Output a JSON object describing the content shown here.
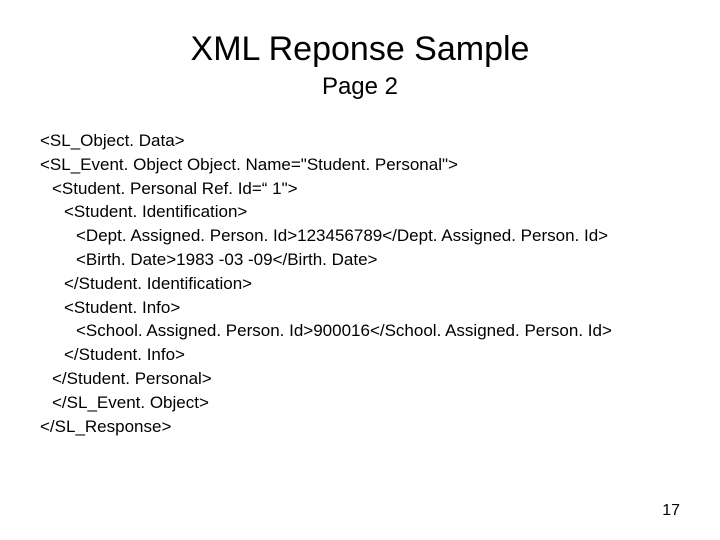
{
  "title": "XML Reponse Sample",
  "subtitle": "Page 2",
  "code_lines": [
    {
      "text": "<SL_Object. Data>",
      "indent": 0
    },
    {
      "text": "<SL_Event. Object Object. Name=\"Student. Personal\">",
      "indent": 0
    },
    {
      "text": "<Student. Personal Ref. Id=“ 1\">",
      "indent": 1
    },
    {
      "text": "<Student. Identification>",
      "indent": 2
    },
    {
      "text": "<Dept. Assigned. Person. Id>123456789</Dept. Assigned. Person. Id>",
      "indent": 3
    },
    {
      "text": "<Birth. Date>1983 -03 -09</Birth. Date>",
      "indent": 3
    },
    {
      "text": "</Student. Identification>",
      "indent": 2
    },
    {
      "text": "<Student. Info>",
      "indent": 2
    },
    {
      "text": "<School. Assigned. Person. Id>900016</School. Assigned. Person. Id>",
      "indent": 3
    },
    {
      "text": "</Student. Info>",
      "indent": 2
    },
    {
      "text": "</Student. Personal>",
      "indent": 1
    },
    {
      "text": "</SL_Event. Object>",
      "indent": 1
    },
    {
      "text": "</SL_Response>",
      "indent": 0
    }
  ],
  "page_number": "17"
}
